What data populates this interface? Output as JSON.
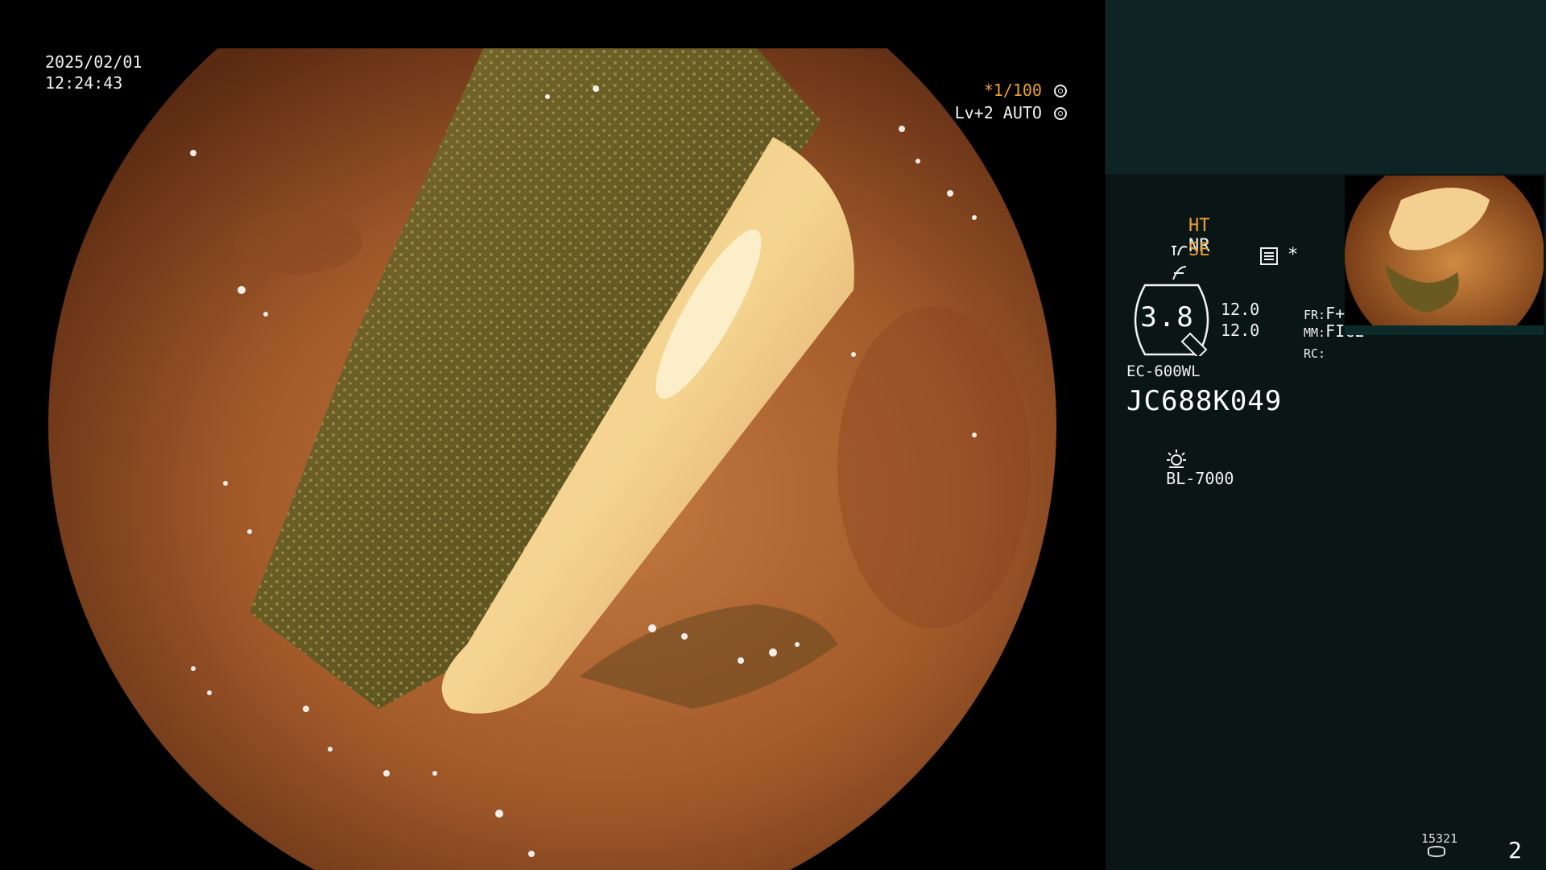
{
  "overlay": {
    "date": "2025/02/01",
    "time": "12:24:43",
    "shutter": "*1/100",
    "level_auto": "Lv+2 AUTO"
  },
  "panel": {
    "ht": "HT",
    "nr": "NR",
    "se": "SE",
    "asterisk": "*",
    "gauge_value": "3.8",
    "val_1": "12.0",
    "val_2": "12.0",
    "fr_label": "FR:",
    "fr_value": "F+T",
    "mm_label": "MM:",
    "mm_value": "FICE",
    "rc_label": "RC:",
    "scope_model": "EC-600WL",
    "serial": "JC688K049",
    "light_source": "BL-7000",
    "image_counter": "15321",
    "page_number": "2"
  },
  "colors": {
    "panel_bg": "#0a1616",
    "panel_top_bg": "#0e2323",
    "accent_orange": "#f0a030",
    "tissue": "#b5632e",
    "bile": "#6a5a22"
  }
}
